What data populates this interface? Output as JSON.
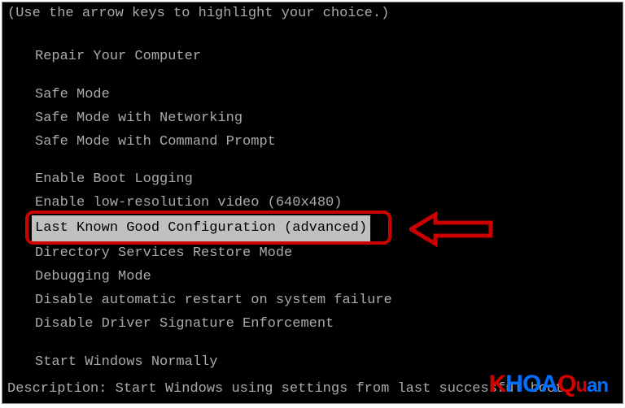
{
  "instruction": "(Use the arrow keys to highlight your choice.)",
  "menu": {
    "group1": [
      "Repair Your Computer"
    ],
    "group2": [
      "Safe Mode",
      "Safe Mode with Networking",
      "Safe Mode with Command Prompt"
    ],
    "group3": [
      "Enable Boot Logging",
      "Enable low-resolution video (640x480)",
      "Last Known Good Configuration (advanced)",
      "Directory Services Restore Mode",
      "Debugging Mode",
      "Disable automatic restart on system failure",
      "Disable Driver Signature Enforcement"
    ],
    "group4": [
      "Start Windows Normally"
    ],
    "selected": "Last Known Good Configuration (advanced)"
  },
  "description_label": "Description:",
  "description_text": "Start Windows using settings from last successful boot",
  "logo": {
    "part_k": "K",
    "part_h": "H",
    "part_oa": "OA",
    "part_q": "Q",
    "part_u": "u",
    "part_an": "an"
  }
}
